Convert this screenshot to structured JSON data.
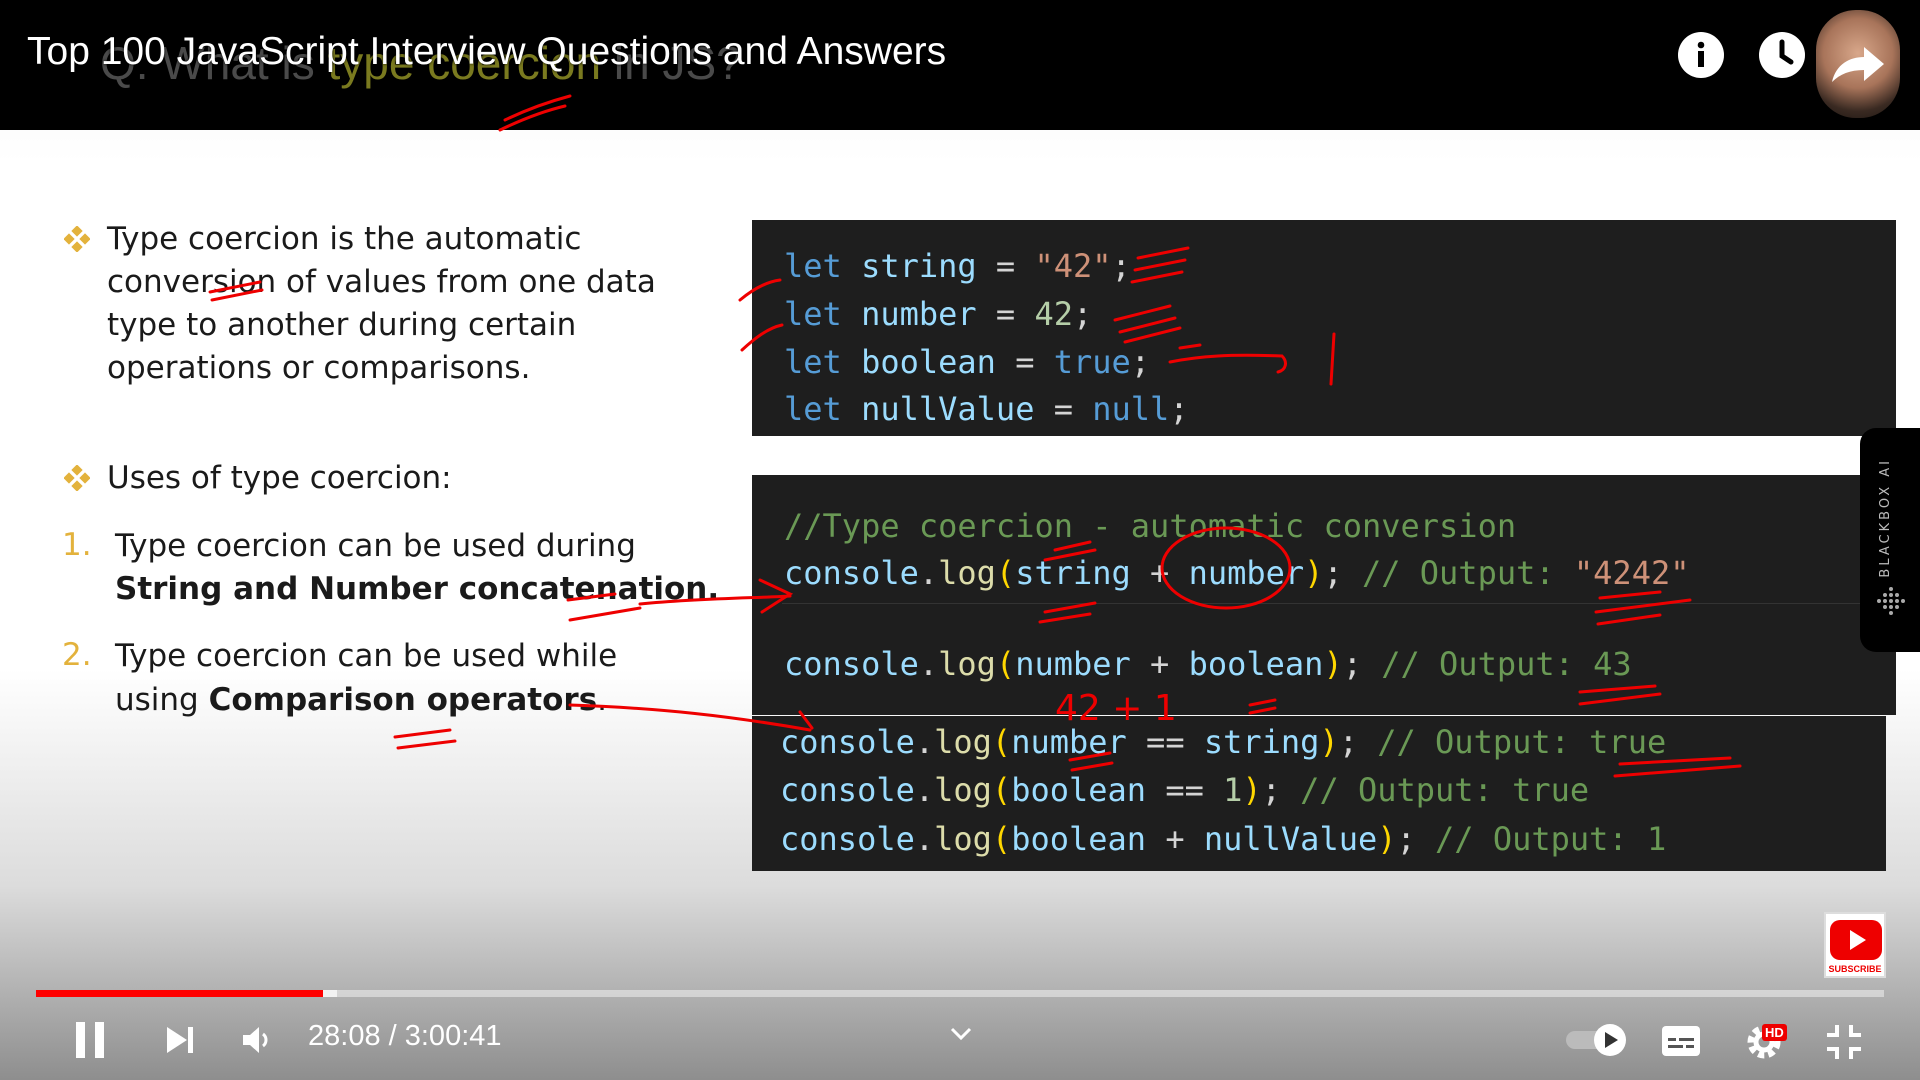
{
  "video": {
    "title": "Top 100 JavaScript Interview Questions and Answers",
    "slide_heading_prefix": "Q. What is ",
    "slide_heading_highlight": "type coercion",
    "slide_heading_suffix": " in JS?"
  },
  "slide": {
    "bullet1": [
      "Type coercion is the automatic",
      "conversion of values from one data",
      "type to another during certain",
      "operations or comparisons."
    ],
    "bullet2": "Uses of type coercion:",
    "item1_num": "1.",
    "item1_line1": "Type coercion can be used during",
    "item1_bold": "String and Number concatenation.",
    "item2_num": "2.",
    "item2_line1": "Type coercion can be used while",
    "item2_pre": "using ",
    "item2_bold": "Comparison operators",
    "item2_post": "."
  },
  "code_top": [
    {
      "kw": "let",
      "id": "string",
      "op": " = ",
      "val": "\"42\"",
      "val_type": "str",
      "end": ";"
    },
    {
      "kw": "let",
      "id": "number",
      "op": " = ",
      "val": "42",
      "val_type": "num",
      "end": ";"
    },
    {
      "kw": "let",
      "id": "boolean",
      "op": " = ",
      "val": "true",
      "val_type": "kw",
      "end": ";"
    },
    {
      "kw": "let",
      "id": "nullValue",
      "op": " = ",
      "val": "null",
      "val_type": "kw",
      "end": ";"
    }
  ],
  "code_bottom": {
    "comment": "//Type coercion - automatic conversion",
    "lines": [
      {
        "fn": "console",
        "method": "log",
        "arg1": "string",
        "op": " + ",
        "arg2": "number",
        "comment": "// Output: ",
        "out": "\"4242\"",
        "out_type": "str"
      },
      {
        "fn": "console",
        "method": "log",
        "arg1": "number",
        "op": " + ",
        "arg2": "boolean",
        "comment": "// Output: 43",
        "out": "",
        "out_type": "cm"
      }
    ]
  },
  "code_third": [
    {
      "arg1": "number",
      "op": " == ",
      "arg2": "string",
      "comment": "// Output: true"
    },
    {
      "arg1": "boolean",
      "op": " == ",
      "arg2": "1",
      "comment": "// Output: true"
    },
    {
      "arg1": "boolean",
      "op": " + ",
      "arg2": "nullValue",
      "comment": "// Output: 1"
    }
  ],
  "annotation_text": "42 + 1",
  "blackbox": {
    "label": "BLACKBOX AI"
  },
  "subscribe": {
    "label": "SUBSCRIBE"
  },
  "player": {
    "current_time": "28:08",
    "separator": " / ",
    "duration": "3:00:41",
    "played_fraction": 0.1555,
    "buffered_fraction": 0.163,
    "hd_label": "HD",
    "progress_color": "#ff0000"
  },
  "icons": {
    "top": [
      "info-icon",
      "watch-later-icon",
      "share-icon"
    ],
    "controls": [
      "pause-icon",
      "next-icon",
      "volume-icon",
      "chevron-down-icon",
      "autoplay-toggle-icon",
      "captions-icon",
      "settings-icon",
      "exit-fullscreen-icon"
    ]
  }
}
